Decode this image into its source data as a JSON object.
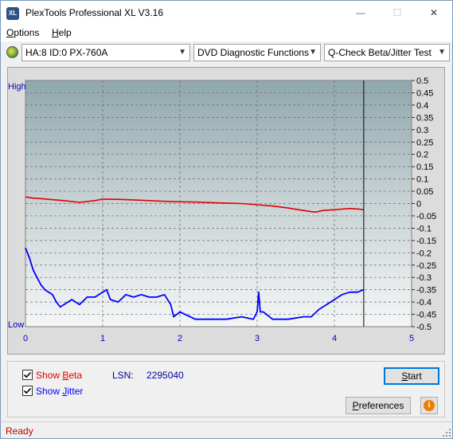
{
  "window": {
    "title": "PlexTools Professional XL V3.16",
    "app_icon_text": "XL",
    "minimize_glyph": "—",
    "maximize_glyph": "☐",
    "close_glyph": "✕"
  },
  "menu": {
    "options": {
      "underline": "O",
      "rest": "ptions"
    },
    "help": {
      "underline": "H",
      "rest": "elp"
    }
  },
  "toolbar": {
    "drive": "HA:8 ID:0  PX-760A",
    "function": "DVD Diagnostic Functions",
    "test": "Q-Check Beta/Jitter Test"
  },
  "chart_data": {
    "type": "line",
    "y_left_labels": {
      "high": "High",
      "low": "Low"
    },
    "x_ticks": [
      "0",
      "1",
      "2",
      "3",
      "4",
      "5"
    ],
    "xlim": [
      0,
      5
    ],
    "y_right_ticks": [
      "0.5",
      "0.45",
      "0.4",
      "0.35",
      "0.3",
      "0.25",
      "0.2",
      "0.15",
      "0.1",
      "0.05",
      "0",
      "-0.05",
      "-0.1",
      "-0.15",
      "-0.2",
      "-0.25",
      "-0.3",
      "-0.35",
      "-0.4",
      "-0.45",
      "-0.5"
    ],
    "ylim": [
      -0.5,
      0.5
    ],
    "grid": true,
    "end_marker_x": 4.38,
    "series": [
      {
        "key": "beta",
        "color": "#e00000",
        "x": [
          0.0,
          0.1,
          0.2,
          0.3,
          0.5,
          0.7,
          0.9,
          1.0,
          1.2,
          1.4,
          1.6,
          1.8,
          2.0,
          2.2,
          2.4,
          2.6,
          2.8,
          3.0,
          3.2,
          3.4,
          3.6,
          3.75,
          3.85,
          4.0,
          4.2,
          4.3,
          4.38
        ],
        "y": [
          0.027,
          0.022,
          0.02,
          0.017,
          0.012,
          0.005,
          0.012,
          0.018,
          0.017,
          0.015,
          0.012,
          0.009,
          0.007,
          0.006,
          0.004,
          0.002,
          0.0,
          -0.005,
          -0.01,
          -0.018,
          -0.028,
          -0.035,
          -0.028,
          -0.025,
          -0.02,
          -0.022,
          -0.025
        ]
      },
      {
        "key": "jitter",
        "color": "#0000ff",
        "x": [
          0.0,
          0.05,
          0.1,
          0.15,
          0.2,
          0.25,
          0.3,
          0.35,
          0.4,
          0.45,
          0.5,
          0.6,
          0.7,
          0.8,
          0.9,
          1.0,
          1.05,
          1.1,
          1.2,
          1.3,
          1.4,
          1.5,
          1.6,
          1.7,
          1.8,
          1.88,
          1.92,
          2.0,
          2.2,
          2.4,
          2.6,
          2.8,
          2.95,
          3.0,
          3.02,
          3.04,
          3.08,
          3.2,
          3.4,
          3.6,
          3.7,
          3.8,
          3.9,
          4.0,
          4.1,
          4.2,
          4.3,
          4.38
        ],
        "y": [
          -0.18,
          -0.22,
          -0.27,
          -0.3,
          -0.33,
          -0.35,
          -0.36,
          -0.37,
          -0.4,
          -0.42,
          -0.41,
          -0.39,
          -0.41,
          -0.38,
          -0.38,
          -0.36,
          -0.35,
          -0.39,
          -0.4,
          -0.37,
          -0.38,
          -0.37,
          -0.38,
          -0.38,
          -0.37,
          -0.41,
          -0.46,
          -0.44,
          -0.47,
          -0.47,
          -0.47,
          -0.46,
          -0.47,
          -0.44,
          -0.36,
          -0.44,
          -0.44,
          -0.47,
          -0.47,
          -0.46,
          -0.46,
          -0.43,
          -0.41,
          -0.39,
          -0.37,
          -0.36,
          -0.36,
          -0.35
        ]
      }
    ]
  },
  "controls": {
    "show_beta": {
      "checked": true,
      "before": "Show ",
      "underline": "B",
      "after": "eta",
      "color": "#e00000"
    },
    "show_jitter": {
      "checked": true,
      "before": "Show ",
      "underline": "J",
      "after": "itter",
      "color": "#0000ff"
    },
    "lsn_label": "LSN:",
    "lsn_value": "2295040",
    "start_button": {
      "underline": "S",
      "rest": "tart"
    },
    "preferences_button": {
      "underline": "P",
      "rest": "references"
    },
    "info_glyph": "i"
  },
  "status": {
    "text": "Ready"
  }
}
